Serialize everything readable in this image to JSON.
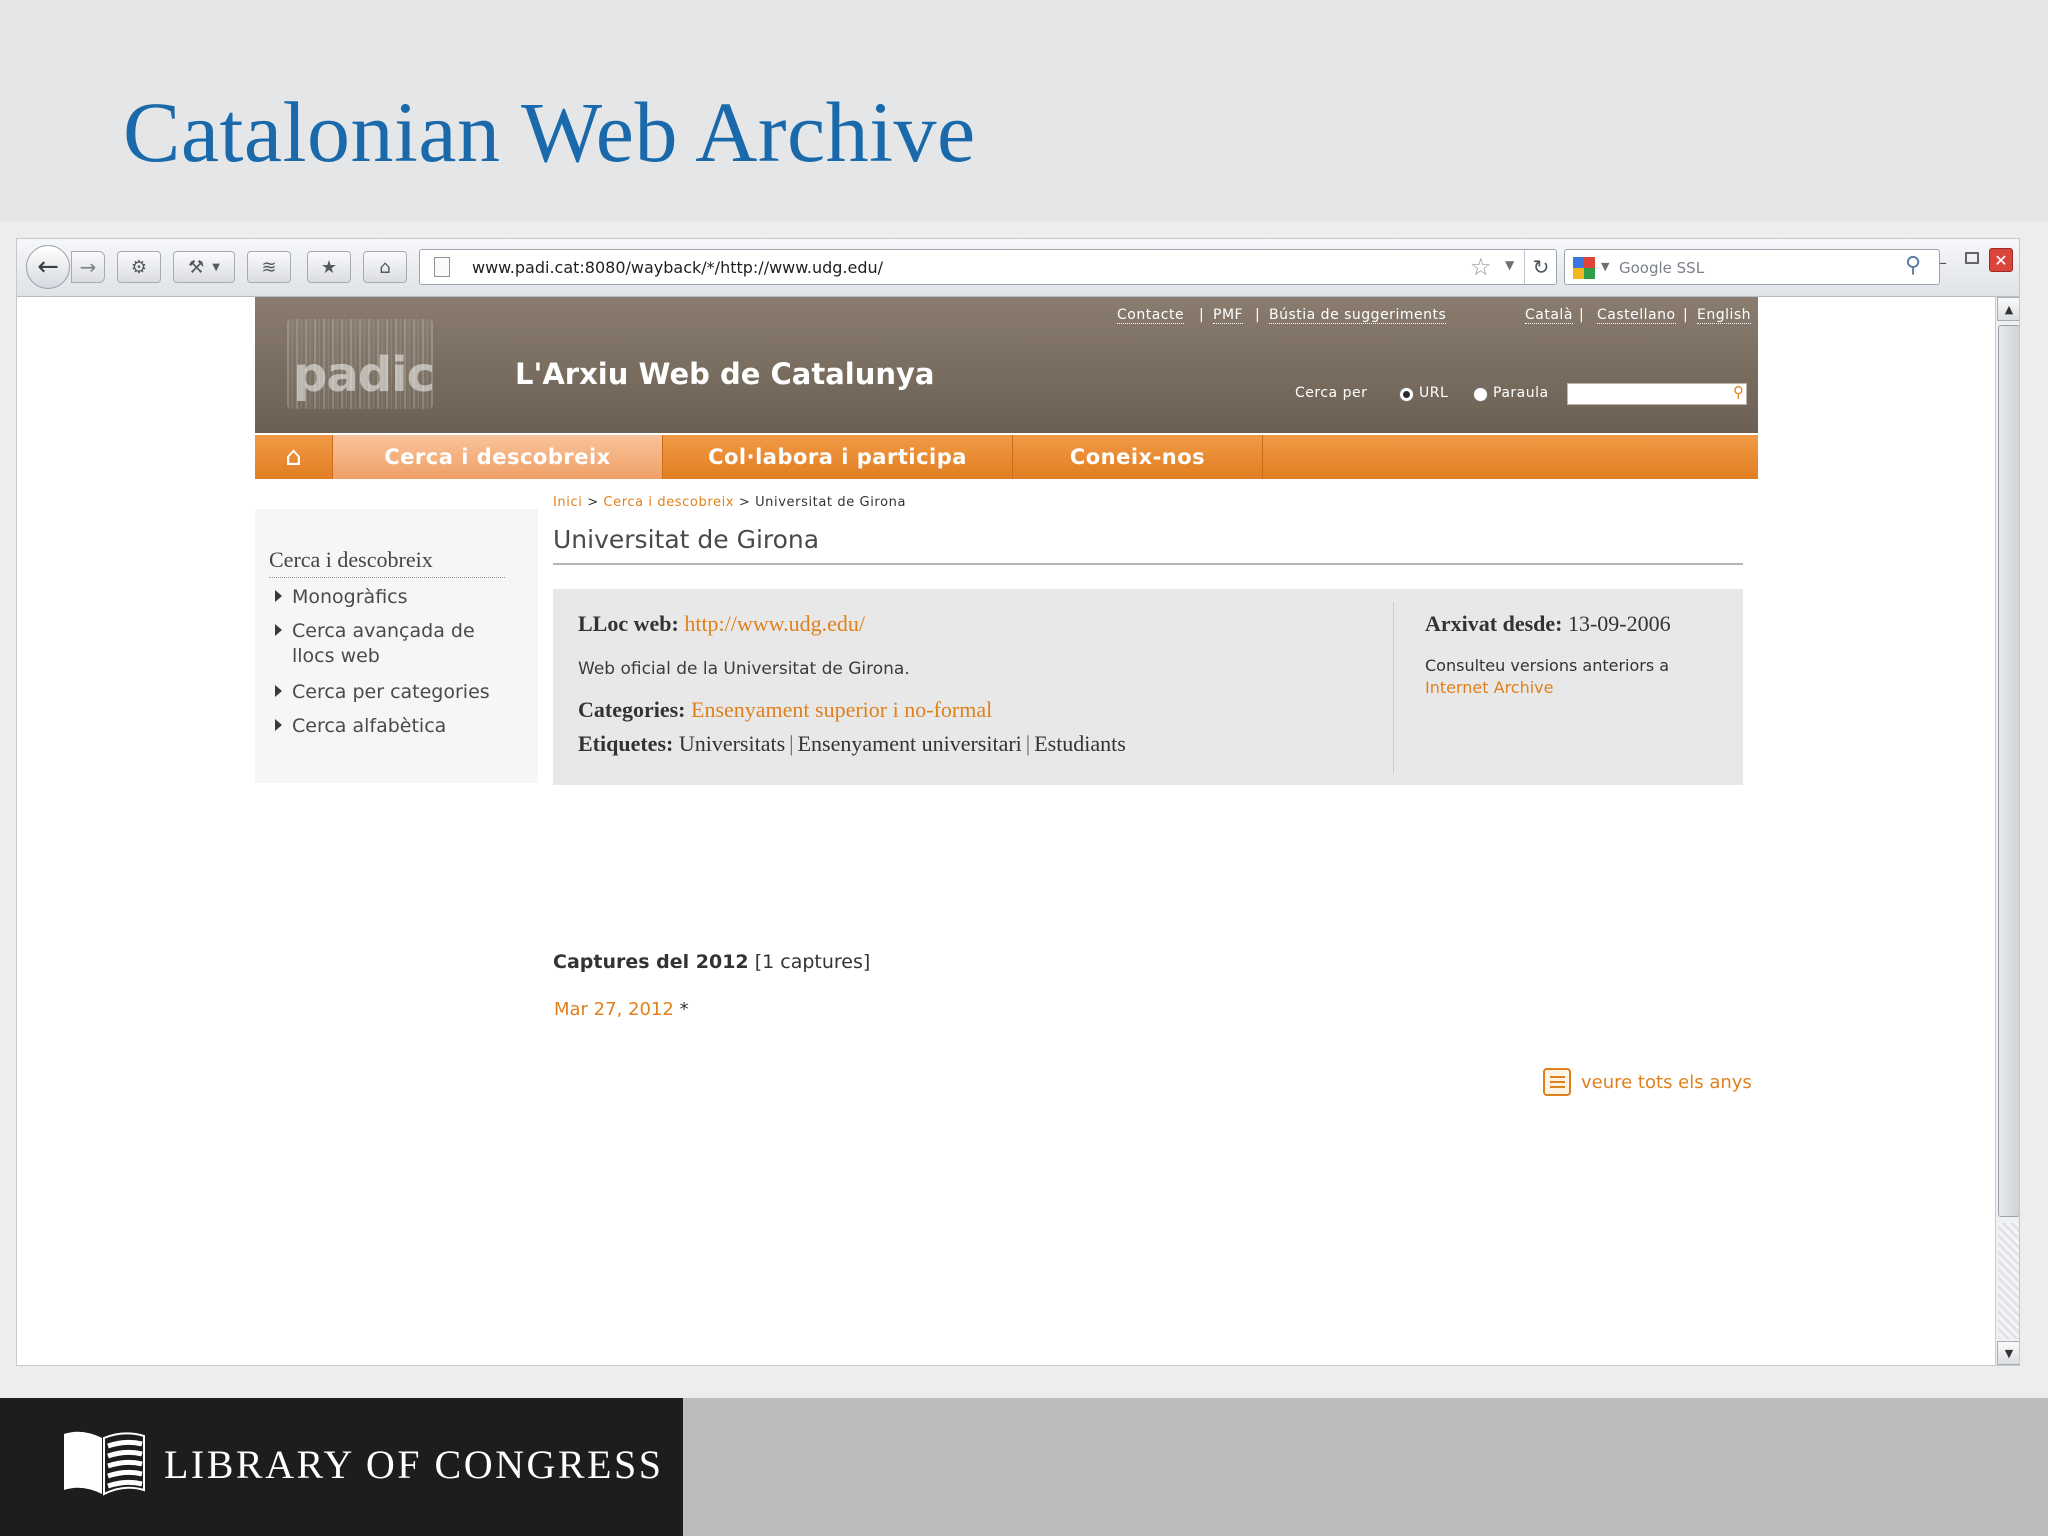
{
  "slide": {
    "title": "Catalonian Web Archive",
    "footer_logo_text": "LIBRARY OF CONGRESS"
  },
  "browser": {
    "url": "www.padi.cat:8080/wayback/*/http://www.udg.edu/",
    "search_placeholder": "Google SSL"
  },
  "site": {
    "logo_text": "padicat",
    "name": "L'Arxiu Web de Catalunya",
    "util_links": [
      "Contacte",
      "PMF",
      "Bústia de suggeriments"
    ],
    "lang_links": [
      "Català",
      "Castellano",
      "English"
    ],
    "search_by_label": "Cerca per",
    "radio_url": "URL",
    "radio_word": "Paraula",
    "menu": [
      "Cerca i descobreix",
      "Col·labora i participa",
      "Coneix-nos"
    ],
    "breadcrumb": {
      "home": "Inici",
      "section": "Cerca i descobreix",
      "current": "Universitat de Girona",
      "separator": ">"
    },
    "page_title": "Universitat de Girona",
    "sidebar": {
      "title": "Cerca i descobreix",
      "items": [
        "Monogràfics",
        "Cerca avançada de llocs web",
        "Cerca per categories",
        "Cerca alfabètica"
      ]
    },
    "info": {
      "site_label": "LLoc web:",
      "site_url": "http://www.udg.edu/",
      "description": "Web oficial de la Universitat de Girona.",
      "categories_label": "Categories:",
      "categories_value": "Ensenyament superior i no-formal",
      "tags_label": "Etiquetes:",
      "tags": [
        "Universitats",
        "Ensenyament universitari",
        "Estudiants"
      ],
      "archived_label": "Arxivat desde:",
      "archived_date": "13-09-2006",
      "archived_note": "Consulteu versions anteriors a",
      "archived_link": "Internet Archive"
    },
    "captures": {
      "heading": "Captures del 2012",
      "count": "[1 captures]",
      "entries": [
        {
          "date": "Mar 27, 2012",
          "marker": "*"
        }
      ],
      "all_years": "veure tots els anys"
    }
  },
  "colors": {
    "title_blue": "#1a6aab",
    "accent_orange": "#e0801c",
    "header_brown": "#7a6e61"
  }
}
